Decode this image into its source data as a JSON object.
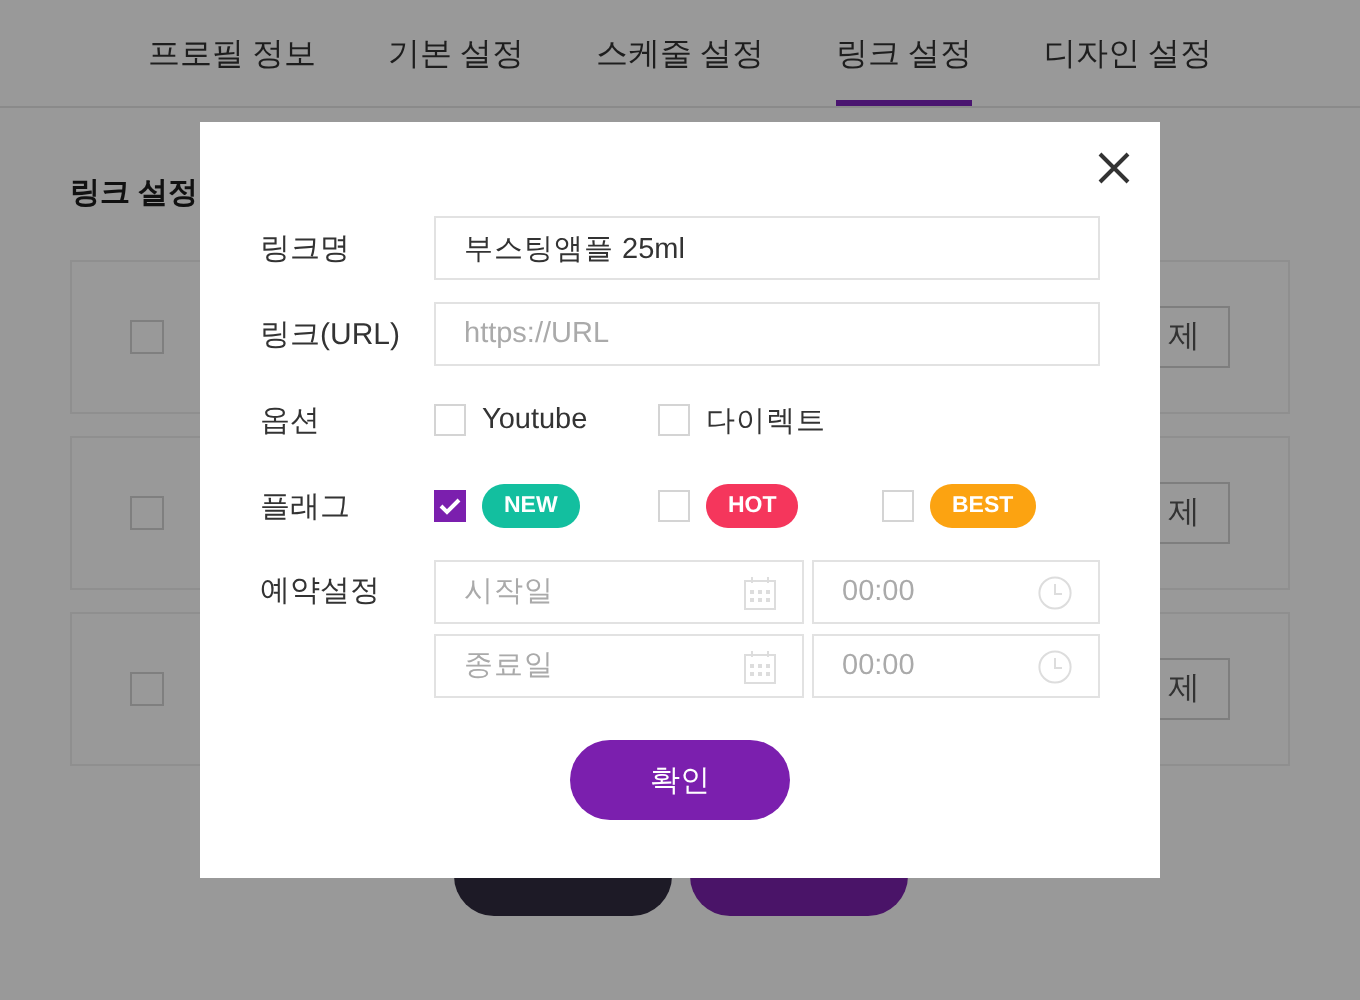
{
  "tabs": [
    {
      "label": "프로필 정보",
      "selected": false
    },
    {
      "label": "기본 설정",
      "selected": false
    },
    {
      "label": "스케줄 설정",
      "selected": false
    },
    {
      "label": "링크 설정",
      "selected": true
    },
    {
      "label": "디자인 설정",
      "selected": false
    }
  ],
  "section_title": "링크 설정",
  "link_rows": [
    {
      "checked": false,
      "delete_button": "제"
    },
    {
      "checked": false,
      "delete_button": "제"
    },
    {
      "checked": false,
      "delete_button": "제"
    }
  ],
  "bottom_buttons": [
    {
      "kind": "dark"
    },
    {
      "kind": "primary"
    }
  ],
  "dialog": {
    "fields": [
      {
        "label": "링크명",
        "value": "부스팅앰플 25ml"
      },
      {
        "label": "링크(URL)",
        "placeholder": "https://URL"
      }
    ],
    "options": {
      "label": "옵션",
      "items": [
        {
          "label": "Youtube",
          "checked": false
        },
        {
          "label": "다이렉트",
          "checked": false
        }
      ]
    },
    "flags": {
      "label": "플래그",
      "items": [
        {
          "label": "NEW",
          "checked": true,
          "color": "#13bf9f"
        },
        {
          "label": "HOT",
          "checked": false,
          "color": "#f5365c"
        },
        {
          "label": "BEST",
          "checked": false,
          "color": "#fca311"
        }
      ]
    },
    "schedule": {
      "label": "예약설정",
      "rows": [
        {
          "date_placeholder": "시작일",
          "time_placeholder": "00:00"
        },
        {
          "date_placeholder": "종료일",
          "time_placeholder": "00:00"
        }
      ]
    },
    "confirm_button": "확인"
  }
}
